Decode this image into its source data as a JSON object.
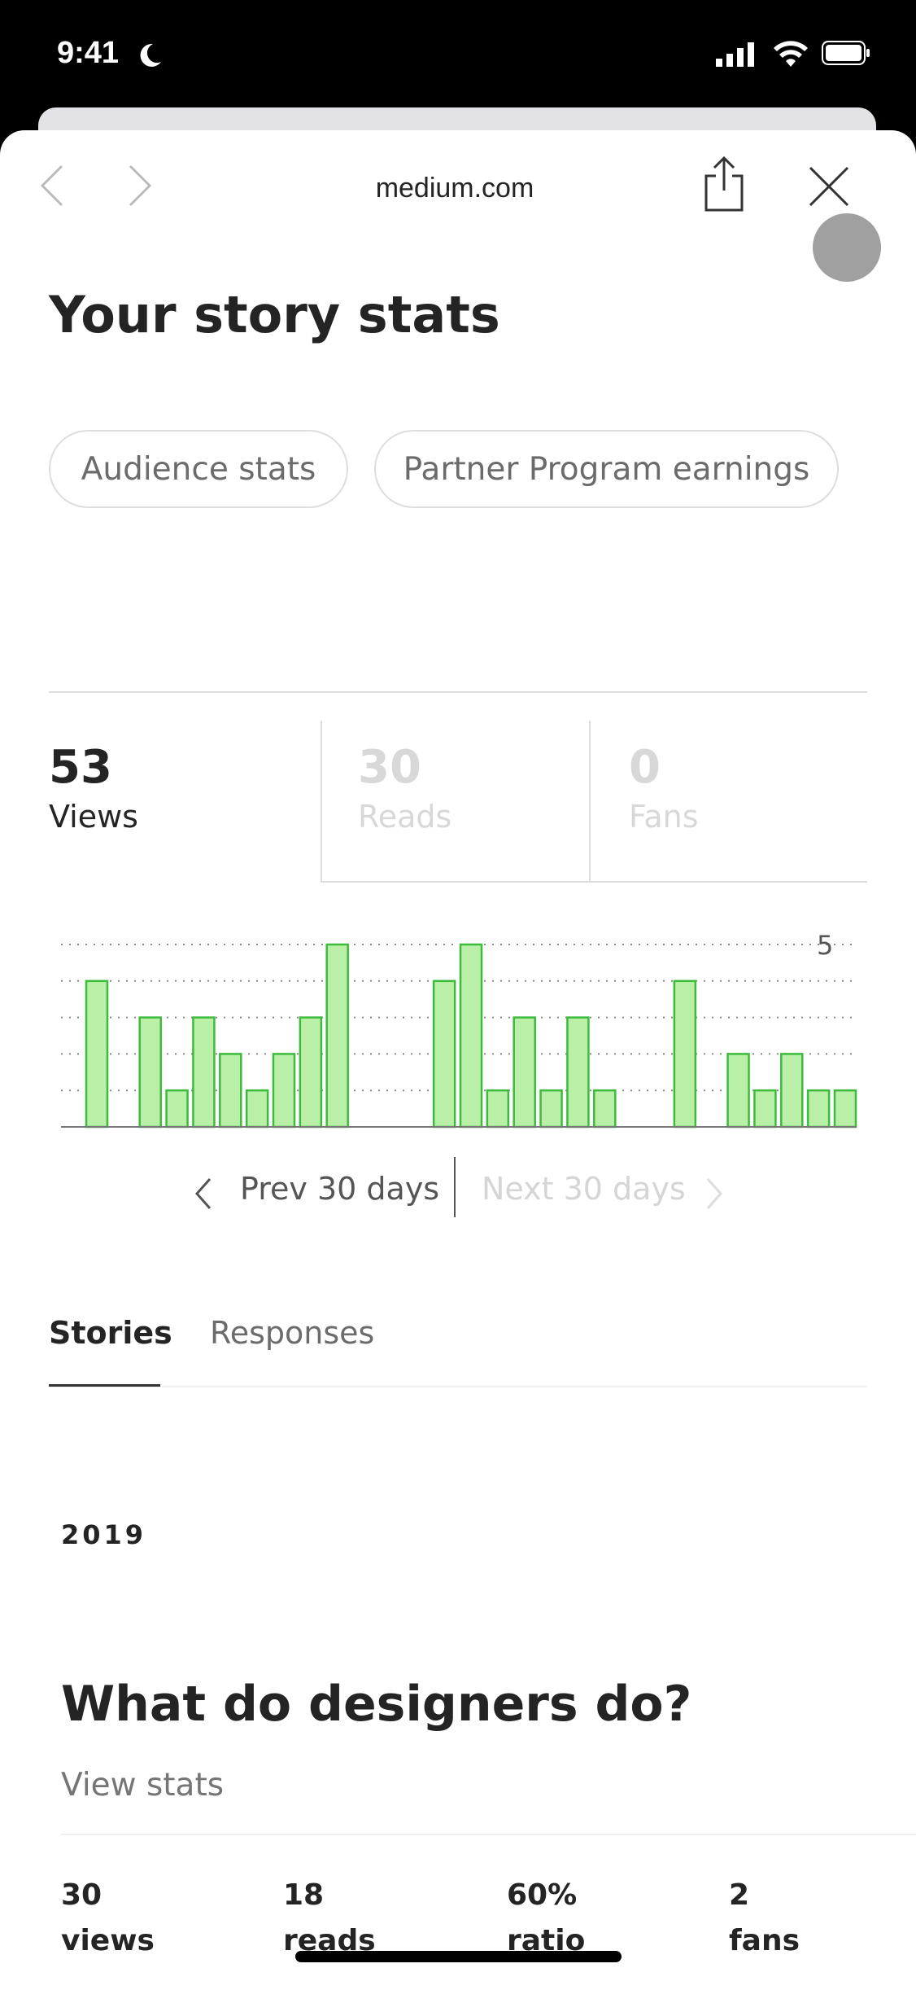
{
  "status_bar": {
    "time": "9:41"
  },
  "browser": {
    "url": "medium.com"
  },
  "page": {
    "title": "Your story stats",
    "pills": [
      "Audience stats",
      "Partner Program earnings"
    ],
    "stat_tabs": [
      {
        "value": "53",
        "label": "Views",
        "active": true
      },
      {
        "value": "30",
        "label": "Reads",
        "active": false
      },
      {
        "value": "0",
        "label": "Fans",
        "active": false
      }
    ],
    "pagination": {
      "prev": "Prev 30 days",
      "next": "Next 30 days"
    },
    "content_tabs": [
      {
        "label": "Stories",
        "active": true
      },
      {
        "label": "Responses",
        "active": false
      }
    ],
    "year": "2019",
    "story": {
      "title": "What do designers do?",
      "link": "View stats",
      "stats": [
        {
          "value": "30",
          "label": "views"
        },
        {
          "value": "18",
          "label": "reads"
        },
        {
          "value": "60%",
          "label": "ratio"
        },
        {
          "value": "2",
          "label": "fans"
        }
      ]
    }
  },
  "chart_data": {
    "type": "bar",
    "ylim": [
      0,
      5
    ],
    "y_tick_label": "5",
    "grid": true,
    "values": [
      4,
      0,
      3,
      1,
      3,
      2,
      1,
      2,
      3,
      5,
      0,
      0,
      0,
      4,
      5,
      1,
      3,
      1,
      3,
      1,
      0,
      0,
      4,
      0,
      2,
      1,
      2,
      1,
      1
    ],
    "bar_fill": "#b9efa6",
    "bar_stroke": "#3dbb3d"
  }
}
